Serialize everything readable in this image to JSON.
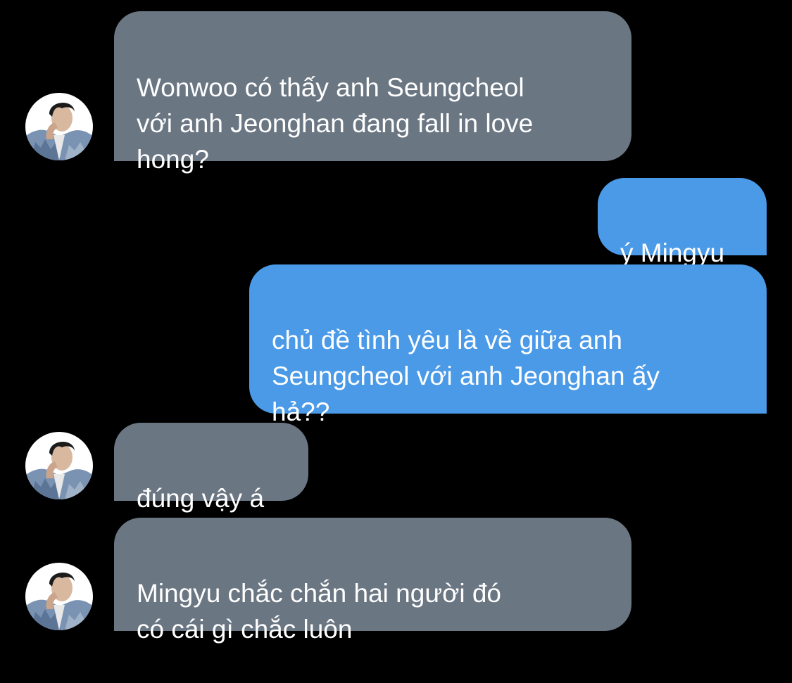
{
  "messages": [
    {
      "sender": "other",
      "text": "Wonwoo có thấy anh Seungcheol\nvới anh Jeonghan đang fall in love\nhong?"
    },
    {
      "sender": "me",
      "text": "ý Mingyu"
    },
    {
      "sender": "me",
      "text": "chủ đề tình yêu là về giữa anh\nSeungcheol với anh Jeonghan ấy\nhả??"
    },
    {
      "sender": "other",
      "text": "đúng vậy á"
    },
    {
      "sender": "other",
      "text": "Mingyu chắc chắn hai người đó\ncó cái gì chắc luôn"
    }
  ],
  "colors": {
    "background": "#000000",
    "received_bubble": "#6b7683",
    "sent_bubble": "#4a9ae8",
    "text": "#ffffff"
  },
  "avatar_icon": "contact-avatar-photo"
}
